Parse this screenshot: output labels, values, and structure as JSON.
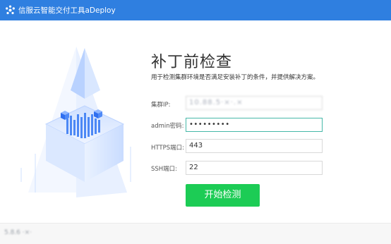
{
  "window": {
    "title": "信服云智能交付工具aDeploy",
    "icon": "app-logo-icon"
  },
  "main": {
    "heading": "补丁前检查",
    "subtitle": "用于检测集群环境是否满足安装补丁的条件，并提供解决方案。"
  },
  "form": {
    "cluster_ip": {
      "label": "集群IP:",
      "value": "10.88.5·×·.×"
    },
    "admin_password": {
      "label": "admin密码:",
      "value": "•••••••••"
    },
    "https_port": {
      "label": "HTTPS端口:",
      "value": "443"
    },
    "ssh_port": {
      "label": "SSH端口:",
      "value": "22"
    }
  },
  "actions": {
    "start_check_label": "开始检测"
  },
  "footer": {
    "version": "5.8.6 ·×·"
  },
  "colors": {
    "titlebar": "#2f7fe0",
    "button": "#1ccc55",
    "focus_border": "#46b8a8",
    "illustration_blue": "#3d7ef5"
  }
}
